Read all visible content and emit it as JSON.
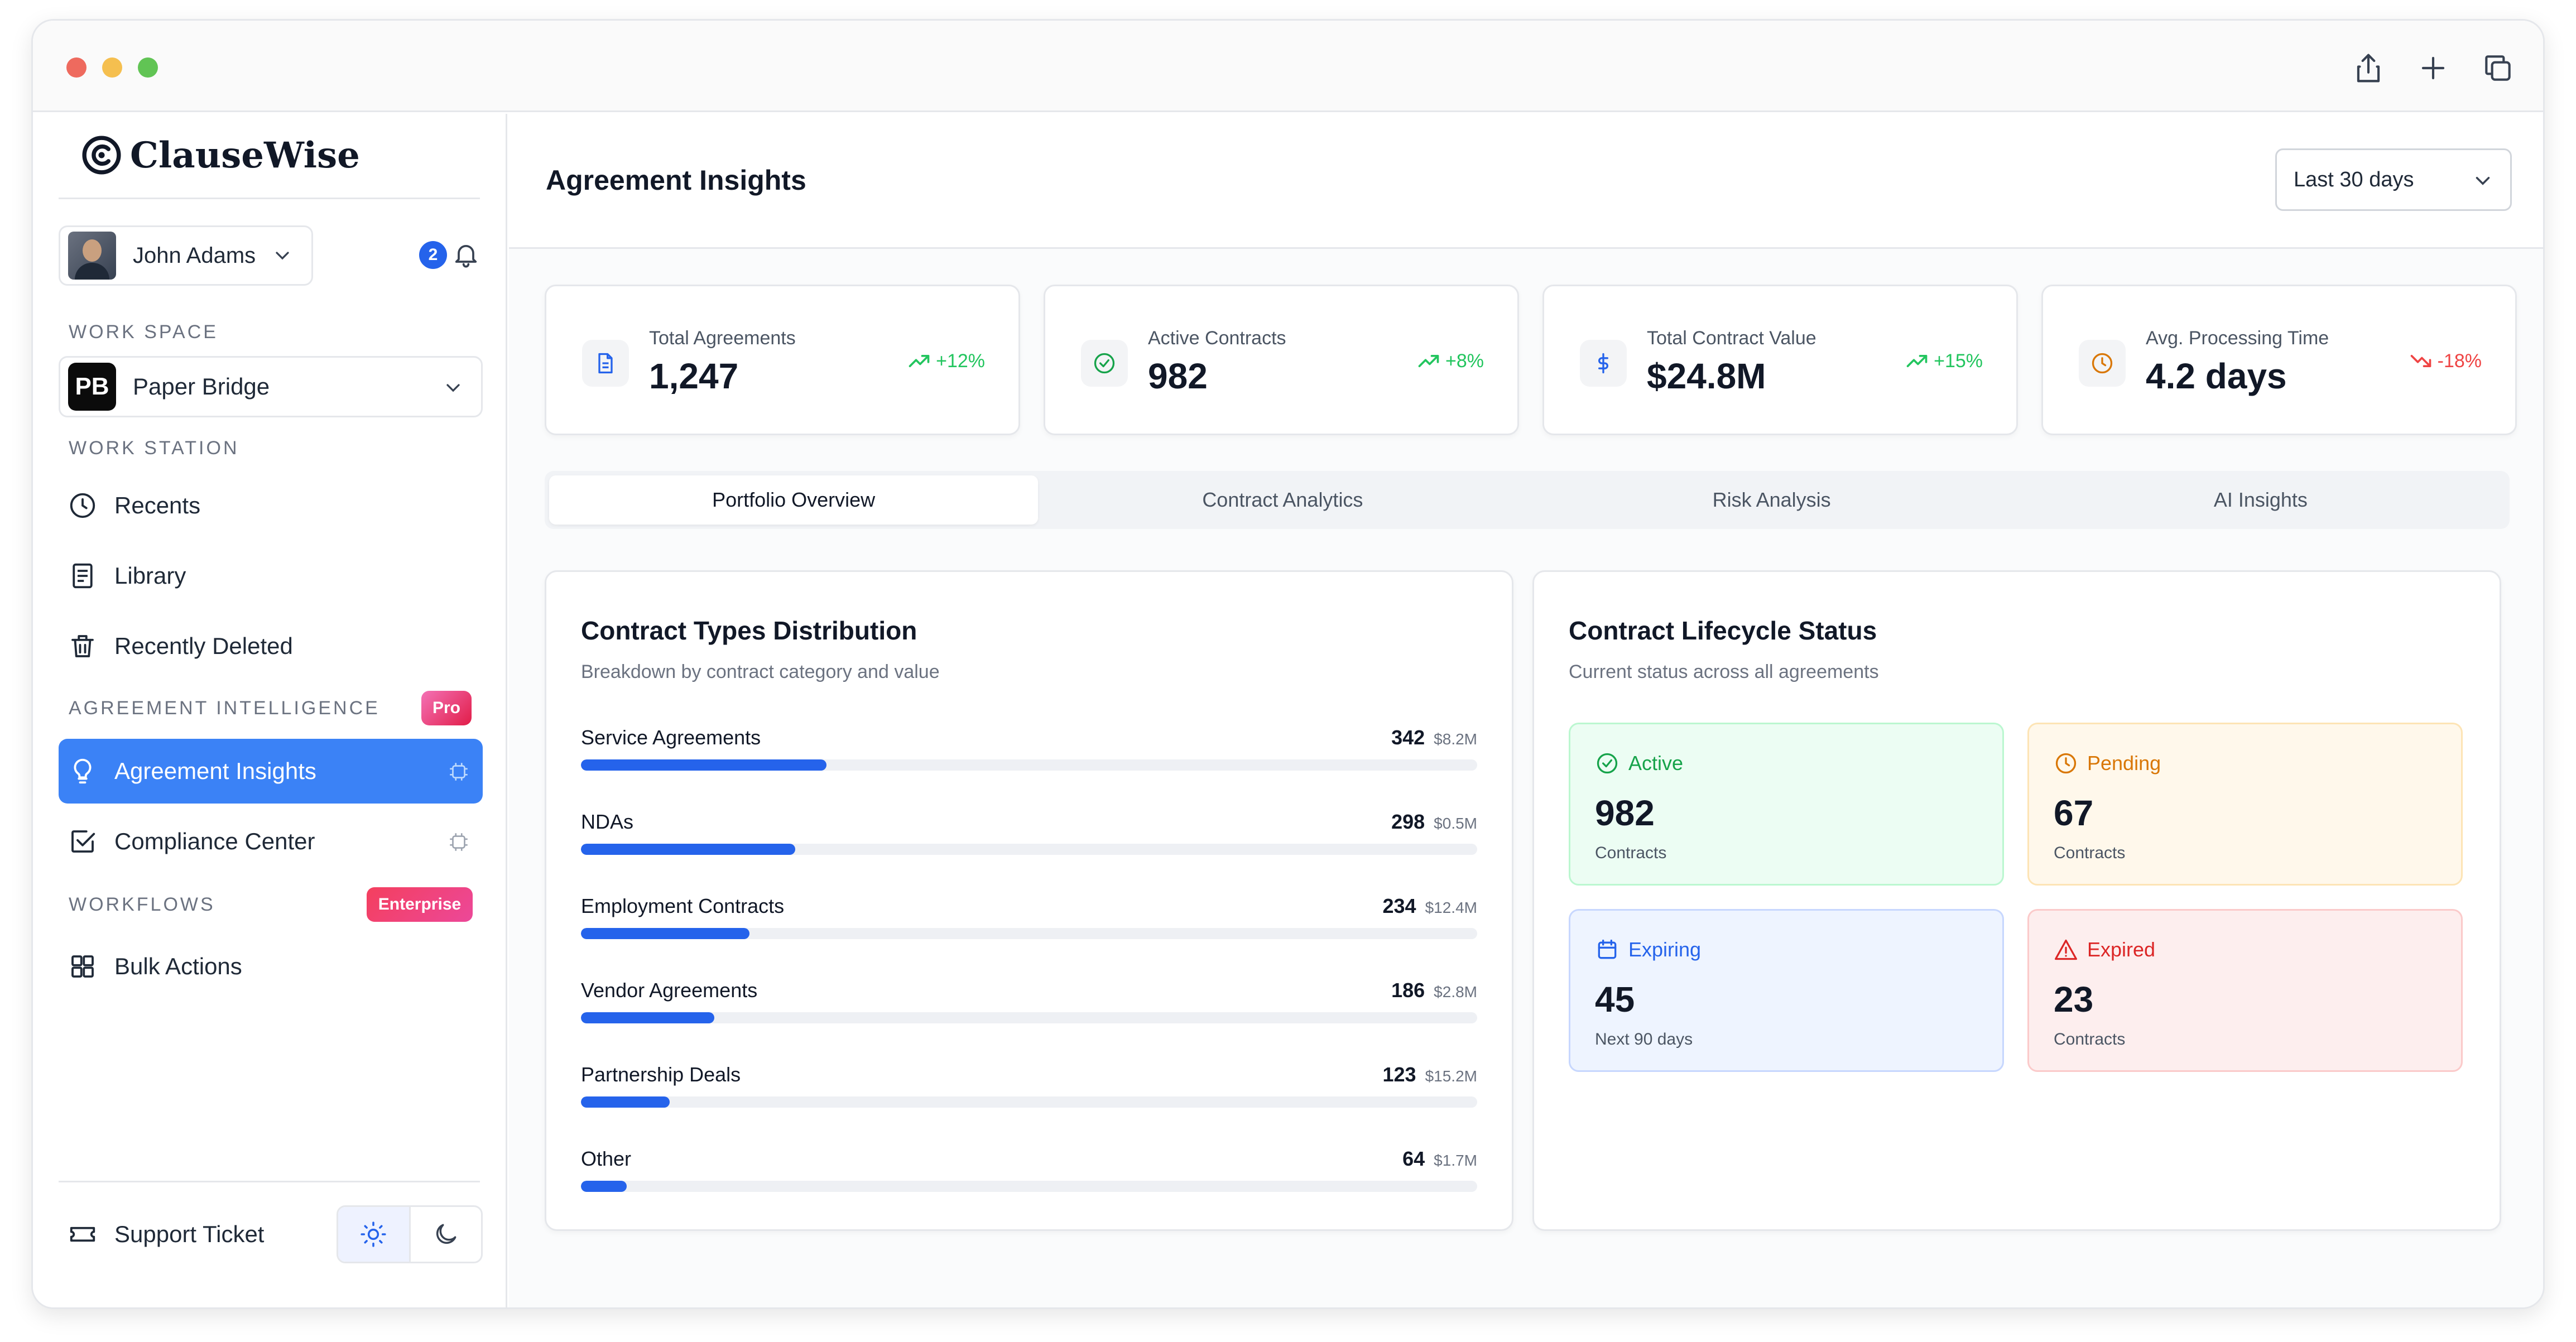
{
  "app": {
    "name": "ClauseWise"
  },
  "user": {
    "name": "John Adams",
    "notifications": "2"
  },
  "sidebar": {
    "workspace_label": "WORK SPACE",
    "workspace": {
      "initials": "PB",
      "name": "Paper Bridge"
    },
    "workstation_label": "WORK STATION",
    "workstation_items": [
      {
        "label": "Recents",
        "icon": "clock-icon"
      },
      {
        "label": "Library",
        "icon": "book-icon"
      },
      {
        "label": "Recently Deleted",
        "icon": "trash-icon"
      }
    ],
    "intelligence_label": "AGREEMENT INTELLIGENCE",
    "intelligence_badge": "Pro",
    "intelligence_items": [
      {
        "label": "Agreement Insights",
        "icon": "lightbulb-icon",
        "active": true
      },
      {
        "label": "Compliance Center",
        "icon": "checkbox-icon",
        "active": false
      }
    ],
    "workflows_label": "WORKFLOWS",
    "workflows_badge": "Enterprise",
    "workflow_items": [
      {
        "label": "Bulk Actions",
        "icon": "grid-icon"
      }
    ],
    "support_label": "Support Ticket"
  },
  "header": {
    "title": "Agreement Insights",
    "range": "Last 30 days"
  },
  "stats": [
    {
      "label": "Total Agreements",
      "value": "1,247",
      "delta": "+12%",
      "trend": "up",
      "icon": "document-icon"
    },
    {
      "label": "Active Contracts",
      "value": "982",
      "delta": "+8%",
      "trend": "up",
      "icon": "check-circle-icon"
    },
    {
      "label": "Total Contract Value",
      "value": "$24.8M",
      "delta": "+15%",
      "trend": "up",
      "icon": "dollar-icon"
    },
    {
      "label": "Avg. Processing Time",
      "value": "4.2 days",
      "delta": "-18%",
      "trend": "down",
      "icon": "clock-icon"
    }
  ],
  "tabs": [
    {
      "label": "Portfolio Overview",
      "active": true
    },
    {
      "label": "Contract Analytics",
      "active": false
    },
    {
      "label": "Risk Analysis",
      "active": false
    },
    {
      "label": "AI Insights",
      "active": false
    }
  ],
  "distribution": {
    "title": "Contract Types Distribution",
    "subtitle": "Breakdown by contract category and value",
    "rows": [
      {
        "name": "Service Agreements",
        "count": "342",
        "value": "$8.2M",
        "fraction": 0.274
      },
      {
        "name": "NDAs",
        "count": "298",
        "value": "$0.5M",
        "fraction": 0.239
      },
      {
        "name": "Employment Contracts",
        "count": "234",
        "value": "$12.4M",
        "fraction": 0.188
      },
      {
        "name": "Vendor Agreements",
        "count": "186",
        "value": "$2.8M",
        "fraction": 0.149
      },
      {
        "name": "Partnership Deals",
        "count": "123",
        "value": "$15.2M",
        "fraction": 0.099
      },
      {
        "name": "Other",
        "count": "64",
        "value": "$1.7M",
        "fraction": 0.051
      }
    ]
  },
  "lifecycle": {
    "title": "Contract Lifecycle Status",
    "subtitle": "Current status across all agreements",
    "cards": [
      {
        "label": "Active",
        "value": "982",
        "sub": "Contracts",
        "icon": "check-circle-icon",
        "color": "#16a34a",
        "bg": "#ecfdf3",
        "border": "#bbf7d0"
      },
      {
        "label": "Pending",
        "value": "67",
        "sub": "Contracts",
        "icon": "clock-icon",
        "color": "#d97706",
        "bg": "#fff8eb",
        "border": "#fde4b5"
      },
      {
        "label": "Expiring",
        "value": "45",
        "sub": "Next 90 days",
        "icon": "calendar-icon",
        "color": "#2563eb",
        "bg": "#eef4ff",
        "border": "#c7d7fe"
      },
      {
        "label": "Expired",
        "value": "23",
        "sub": "Contracts",
        "icon": "warning-icon",
        "color": "#dc2626",
        "bg": "#fdeeee",
        "border": "#fbcaca"
      }
    ]
  },
  "colors": {
    "accent": "#3b82f6",
    "bar": "#2563eb",
    "up": "#22c55e",
    "down": "#ef4444",
    "pro": "#ec4899",
    "enterprise": "#f43f5e"
  }
}
